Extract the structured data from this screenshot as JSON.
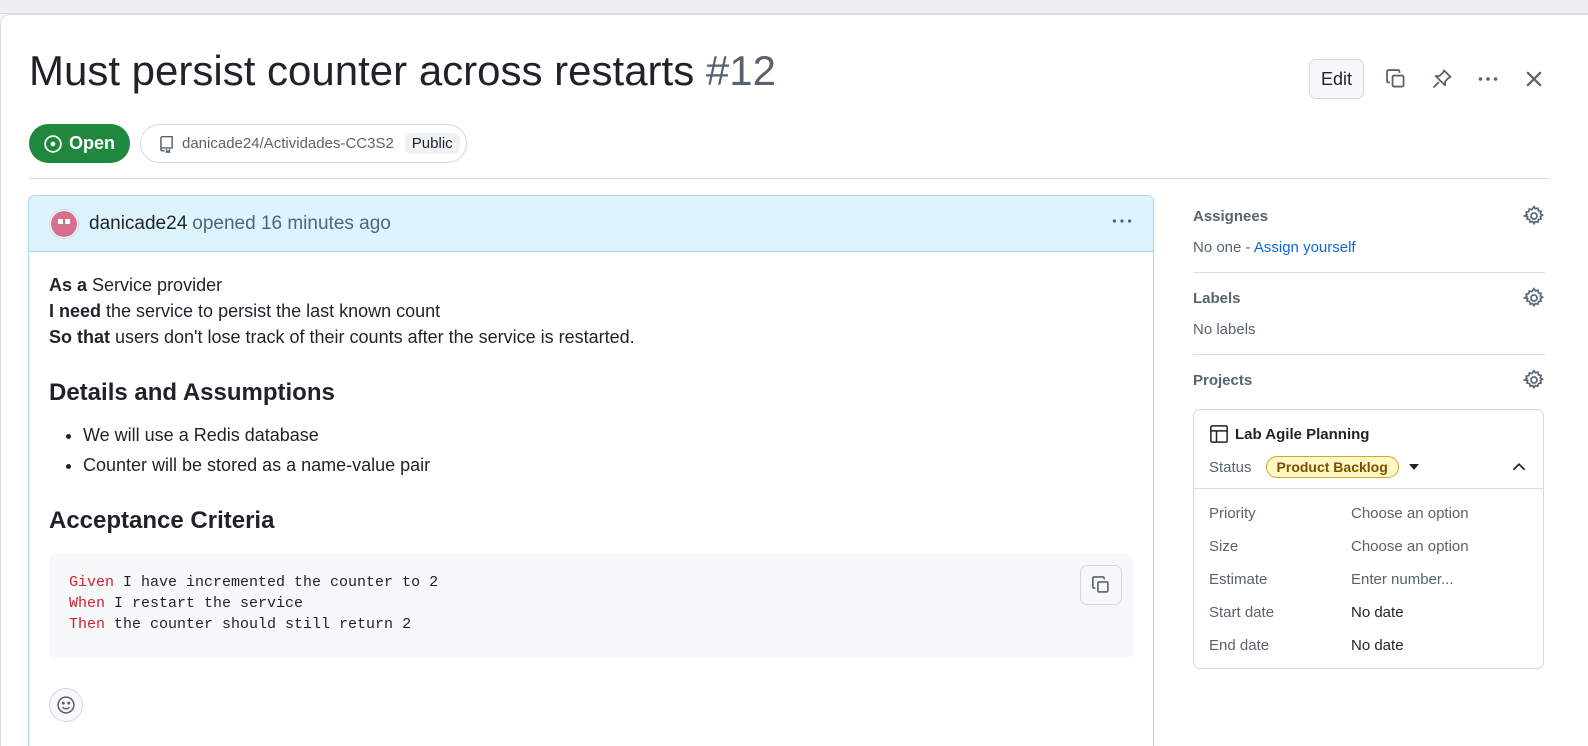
{
  "issue": {
    "title": "Must persist counter across restarts",
    "number": "#12",
    "state": "Open",
    "repo": "danicade24/Actividades-CC3S2",
    "visibility": "Public"
  },
  "header_actions": {
    "edit_label": "Edit",
    "icons": [
      "copy-icon",
      "pin-icon",
      "kebab-icon",
      "close-icon"
    ]
  },
  "comment": {
    "author": "danicade24",
    "meta": "opened 16 minutes ago",
    "story": [
      {
        "bold": "As a",
        "text": " Service provider"
      },
      {
        "bold": "I need",
        "text": " the service to persist the last known count"
      },
      {
        "bold": "So that",
        "text": " users don't lose track of their counts after the service is restarted."
      }
    ],
    "details_heading": "Details and Assumptions",
    "details": [
      "We will use a Redis database",
      "Counter will be stored as a name-value pair"
    ],
    "criteria_heading": "Acceptance Criteria",
    "code_lines": [
      {
        "kw": "Given",
        "text": " I have incremented the counter to 2"
      },
      {
        "kw": "When",
        "text": " I restart the service"
      },
      {
        "kw": "Then",
        "text": " the counter should still return 2"
      }
    ]
  },
  "sidebar": {
    "assignees": {
      "title": "Assignees",
      "value": "No one - ",
      "link": "Assign yourself"
    },
    "labels": {
      "title": "Labels",
      "value": "No labels"
    },
    "projects": {
      "title": "Projects",
      "project_name": "Lab Agile Planning",
      "status_label": "Status",
      "status_value": "Product Backlog",
      "fields": [
        {
          "label": "Priority",
          "value": "Choose an option"
        },
        {
          "label": "Size",
          "value": "Choose an option"
        },
        {
          "label": "Estimate",
          "value": "Enter number..."
        },
        {
          "label": "Start date",
          "value": "No date"
        },
        {
          "label": "End date",
          "value": "No date"
        }
      ]
    }
  },
  "colors": {
    "open_green": "#1f883d",
    "link_blue": "#0969da",
    "keyword_red": "#cf222e",
    "comment_header_bg": "#ddf4ff",
    "status_badge_bg": "#fff8c5"
  }
}
